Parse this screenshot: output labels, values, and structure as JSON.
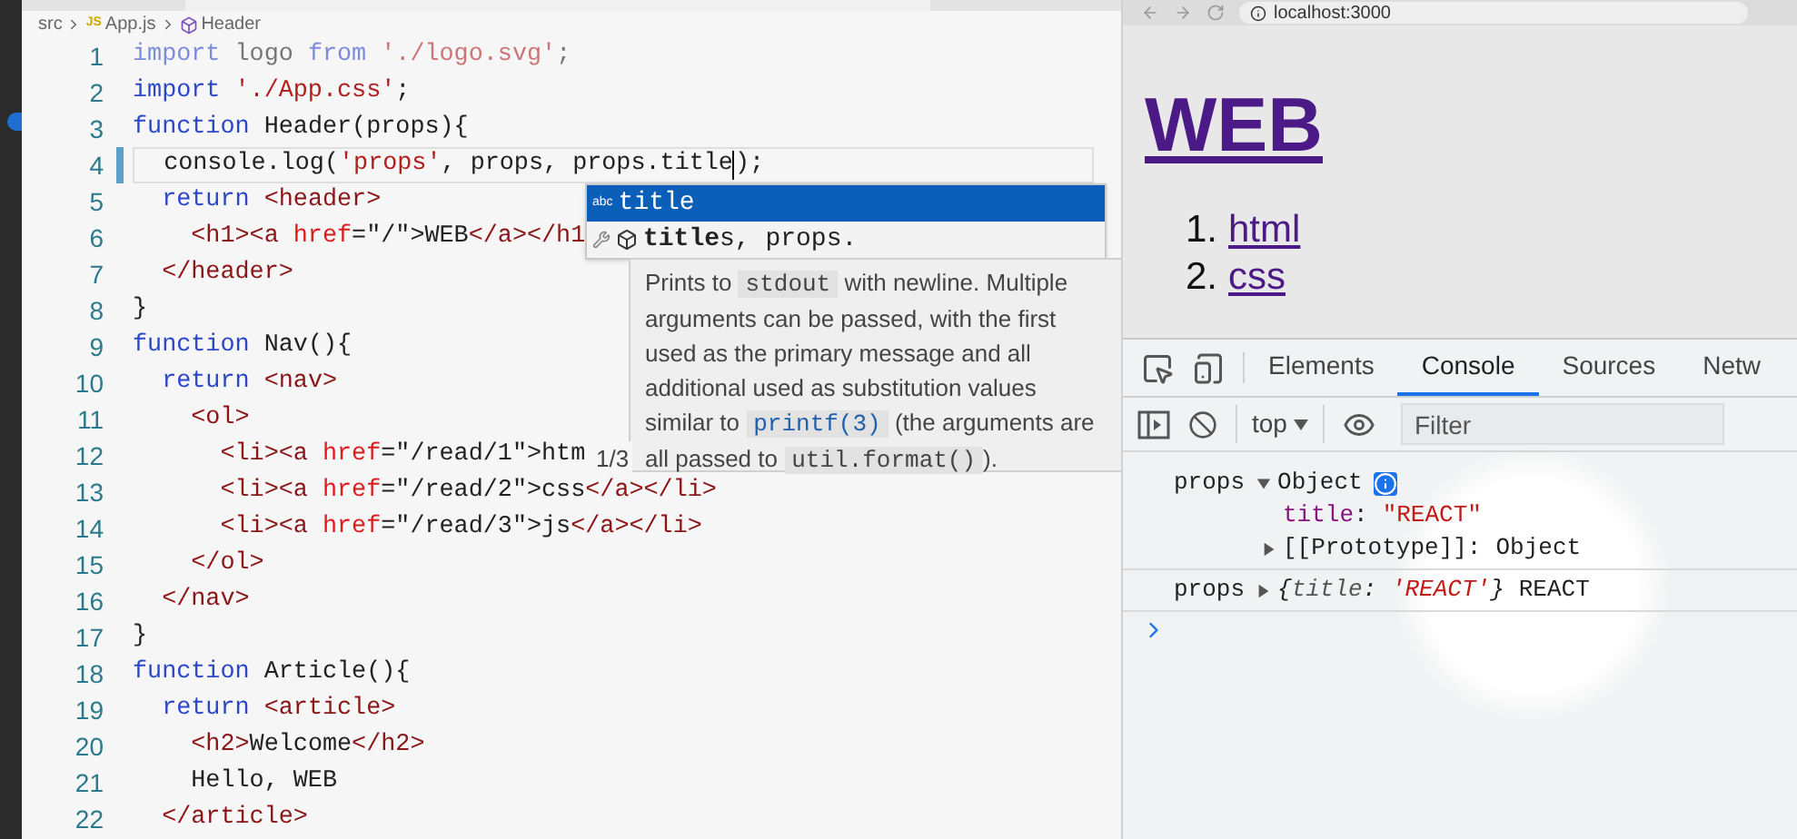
{
  "editor": {
    "breadcrumb": [
      {
        "kind": "folder",
        "label": "src"
      },
      {
        "kind": "file",
        "badge": "JS",
        "label": "App.js"
      },
      {
        "kind": "symbol",
        "label": "Header"
      }
    ],
    "lines": [
      {
        "number": "1",
        "dimmed": true,
        "current": false,
        "tokens": [
          {
            "kind": "keyword",
            "text": "import"
          },
          {
            "kind": "text",
            "text": " logo "
          },
          {
            "kind": "keyword",
            "text": "from"
          },
          {
            "kind": "string",
            "text": " './logo.svg'"
          },
          {
            "kind": "text",
            "text": ";"
          }
        ]
      },
      {
        "number": "2",
        "dimmed": false,
        "current": false,
        "tokens": [
          {
            "kind": "keyword",
            "text": "import"
          },
          {
            "kind": "string",
            "text": " './App.css'"
          },
          {
            "kind": "text",
            "text": ";"
          }
        ]
      },
      {
        "number": "3",
        "dimmed": false,
        "current": false,
        "tokens": [
          {
            "kind": "keyword",
            "text": "function"
          },
          {
            "kind": "text",
            "text": " Header(props){"
          }
        ]
      },
      {
        "number": "4",
        "dimmed": false,
        "current": true,
        "tokens": [
          {
            "kind": "text",
            "text": "  console.log("
          },
          {
            "kind": "string",
            "text": "'props'"
          },
          {
            "kind": "text",
            "text": ", props, props.title",
            "cursor": true
          },
          {
            "kind": "text",
            "text": ");"
          }
        ]
      },
      {
        "number": "5",
        "dimmed": false,
        "current": false,
        "tokens": [
          {
            "kind": "keyword",
            "text": "  return"
          },
          {
            "kind": "tag",
            "text": " <header>"
          }
        ]
      },
      {
        "number": "6",
        "dimmed": false,
        "current": false,
        "tokens": [
          {
            "kind": "tag",
            "text": "    <h1><a"
          },
          {
            "kind": "attr",
            "text": " href"
          },
          {
            "kind": "text",
            "text": "=\"/\">WEB"
          },
          {
            "kind": "tag",
            "text": "</a></h1"
          }
        ]
      },
      {
        "number": "7",
        "dimmed": false,
        "current": false,
        "tokens": [
          {
            "kind": "tag",
            "text": "  </header>"
          }
        ]
      },
      {
        "number": "8",
        "dimmed": false,
        "current": false,
        "tokens": [
          {
            "kind": "text",
            "text": "}"
          }
        ]
      },
      {
        "number": "9",
        "dimmed": false,
        "current": false,
        "tokens": [
          {
            "kind": "keyword",
            "text": "function"
          },
          {
            "kind": "text",
            "text": " Nav(){"
          }
        ]
      },
      {
        "number": "10",
        "dimmed": false,
        "current": false,
        "tokens": [
          {
            "kind": "keyword",
            "text": "  return"
          },
          {
            "kind": "tag",
            "text": " <nav>"
          }
        ]
      },
      {
        "number": "11",
        "dimmed": false,
        "current": false,
        "tokens": [
          {
            "kind": "tag",
            "text": "    <ol>"
          }
        ]
      },
      {
        "number": "12",
        "dimmed": false,
        "current": false,
        "tokens": [
          {
            "kind": "tag",
            "text": "      <li><a"
          },
          {
            "kind": "attr",
            "text": " href"
          },
          {
            "kind": "text",
            "text": "=\"/read/1\">htm"
          }
        ]
      },
      {
        "number": "13",
        "dimmed": false,
        "current": false,
        "tokens": [
          {
            "kind": "tag",
            "text": "      <li><a"
          },
          {
            "kind": "attr",
            "text": " href"
          },
          {
            "kind": "text",
            "text": "=\"/read/2\">css"
          },
          {
            "kind": "tag",
            "text": "</a></li>"
          }
        ]
      },
      {
        "number": "14",
        "dimmed": false,
        "current": false,
        "tokens": [
          {
            "kind": "tag",
            "text": "      <li><a"
          },
          {
            "kind": "attr",
            "text": " href"
          },
          {
            "kind": "text",
            "text": "=\"/read/3\">js"
          },
          {
            "kind": "tag",
            "text": "</a></li>"
          }
        ]
      },
      {
        "number": "15",
        "dimmed": false,
        "current": false,
        "tokens": [
          {
            "kind": "tag",
            "text": "    </ol>"
          }
        ]
      },
      {
        "number": "16",
        "dimmed": false,
        "current": false,
        "tokens": [
          {
            "kind": "tag",
            "text": "  </nav>"
          }
        ]
      },
      {
        "number": "17",
        "dimmed": false,
        "current": false,
        "tokens": [
          {
            "kind": "text",
            "text": "}"
          }
        ]
      },
      {
        "number": "18",
        "dimmed": false,
        "current": false,
        "tokens": [
          {
            "kind": "keyword",
            "text": "function"
          },
          {
            "kind": "text",
            "text": " Article(){"
          }
        ]
      },
      {
        "number": "19",
        "dimmed": false,
        "current": false,
        "tokens": [
          {
            "kind": "keyword",
            "text": "  return"
          },
          {
            "kind": "tag",
            "text": " <article>"
          }
        ]
      },
      {
        "number": "20",
        "dimmed": false,
        "current": false,
        "tokens": [
          {
            "kind": "tag",
            "text": "    <h2>"
          },
          {
            "kind": "text",
            "text": "Welcome"
          },
          {
            "kind": "tag",
            "text": "</h2>"
          }
        ]
      },
      {
        "number": "21",
        "dimmed": false,
        "current": false,
        "tokens": [
          {
            "kind": "text",
            "text": "    Hello, WEB"
          }
        ]
      },
      {
        "number": "22",
        "dimmed": false,
        "current": false,
        "tokens": [
          {
            "kind": "tag",
            "text": "  </article>"
          }
        ]
      }
    ],
    "suggest": {
      "items": [
        {
          "kind": "word",
          "badge": "abc",
          "label": "title",
          "selected": true
        },
        {
          "kind": "snippet",
          "label": "**title**s, props.",
          "selected": false
        }
      ],
      "doc": [
        {
          "kind": "text",
          "text": "Prints to "
        },
        {
          "kind": "code",
          "text": "stdout"
        },
        {
          "kind": "text",
          "text": " with newline. Multiple arguments can be passed, with the first used as the primary message and all additional used as substitution values similar to "
        },
        {
          "kind": "link",
          "text": "printf(3)"
        },
        {
          "kind": "text",
          "text": " (the arguments are all passed to "
        },
        {
          "kind": "code",
          "text": "util.format()"
        },
        {
          "kind": "text",
          "text": ")."
        }
      ],
      "counter": "1/3"
    }
  },
  "browser": {
    "url": "localhost:3000",
    "heading": "WEB",
    "list": [
      {
        "number": "1.",
        "label": "html"
      },
      {
        "number": "2.",
        "label": "css"
      }
    ]
  },
  "devtools": {
    "tabs": [
      {
        "label": "Elements",
        "selected": false
      },
      {
        "label": "Console",
        "selected": true
      },
      {
        "label": "Sources",
        "selected": false
      },
      {
        "label": "Netw",
        "selected": false
      }
    ],
    "context": "top",
    "filter": {
      "placeholder": "Filter"
    },
    "messages": [
      {
        "label": "props",
        "expanded": true,
        "summary": "Object",
        "info": true,
        "children": [
          {
            "kind": "property",
            "key": "title",
            "separator": ":",
            "value": "\"REACT\""
          },
          {
            "kind": "prototype",
            "key": "[[Prototype]]",
            "separator": ":",
            "value": "Object",
            "expanded": false
          }
        ]
      },
      {
        "label": "props",
        "expanded": false,
        "preview": [
          {
            "kind": "punct",
            "text": "{"
          },
          {
            "kind": "key",
            "text": "title"
          },
          {
            "kind": "punct",
            "text": ": "
          },
          {
            "kind": "string",
            "text": "'REACT'"
          },
          {
            "kind": "punct",
            "text": "}"
          }
        ],
        "extra": "REACT"
      }
    ]
  }
}
